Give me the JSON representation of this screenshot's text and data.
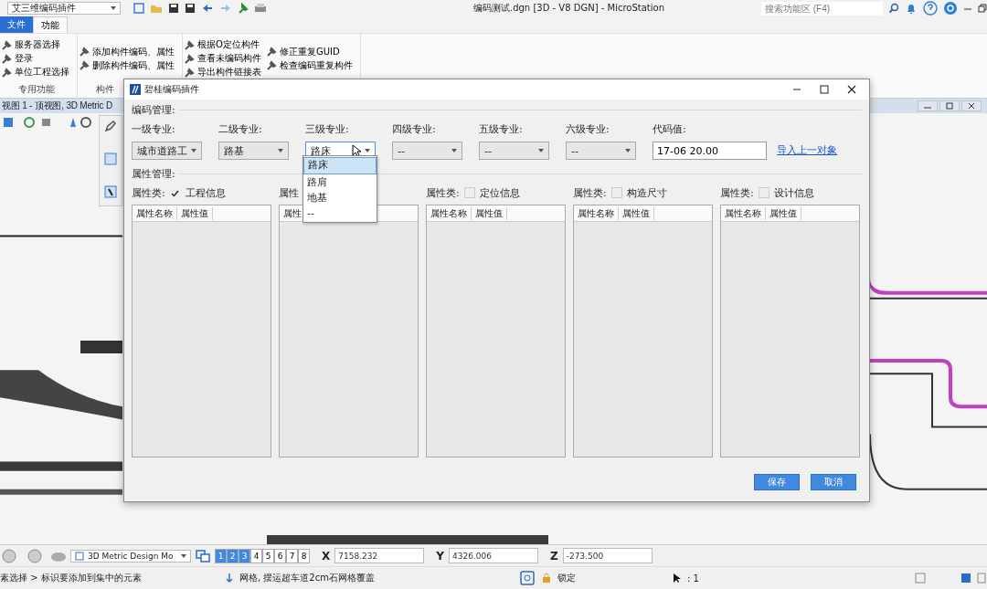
{
  "app_bar": {
    "workflow": "艾三维编码插件",
    "title": "编码测试.dgn [3D - V8 DGN] - MicroStation",
    "search": {
      "placeholder": "搜索功能区 (F4)"
    }
  },
  "ribbon": {
    "tabs": [
      {
        "label": "文件",
        "kind": "file",
        "selected": false
      },
      {
        "label": "功能",
        "kind": "tab",
        "selected": true
      }
    ],
    "groups": [
      {
        "label": "专用功能",
        "columns": [
          [
            "服务器选择",
            "登录",
            "单位工程选择"
          ]
        ]
      },
      {
        "label": "构件",
        "columns": [
          [
            "添加构件编码、属性",
            "删除构件编码、属性"
          ]
        ]
      },
      {
        "columns": [
          [
            "根据O定位构件",
            "查看未编码构件",
            "导出构件链接表"
          ],
          [
            "修正重复GUID",
            "检查编码重复构件"
          ]
        ]
      }
    ]
  },
  "view": {
    "title": "视图 1 - 顶视图, 3D Metric D"
  },
  "dialog": {
    "title": "碧桂编码插件",
    "code_section": "编码管理:",
    "levels": [
      {
        "label": "一级专业:",
        "value": "城市道路工",
        "expanded": false
      },
      {
        "label": "二级专业:",
        "value": "路基",
        "expanded": false
      },
      {
        "label": "三级专业:",
        "value": "路床",
        "expanded": true,
        "options": [
          {
            "label": "路床",
            "selected": true
          },
          {
            "label": "路肩",
            "selected": false
          },
          {
            "label": "地基",
            "selected": false
          },
          {
            "label": "--",
            "selected": false
          }
        ]
      },
      {
        "label": "四级专业:",
        "value": "--",
        "expanded": false
      },
      {
        "label": "五级专业:",
        "value": "--",
        "expanded": false
      },
      {
        "label": "六级专业:",
        "value": "--",
        "expanded": false
      }
    ],
    "code": {
      "label": "代码值:",
      "value": "17-06 20.00"
    },
    "import_link": "导入上一对象",
    "attr_section": "属性管理:",
    "panels": [
      {
        "label": "属性类:",
        "checked": true,
        "name": "工程信息",
        "columns": [
          "属性名称",
          "属性值"
        ]
      },
      {
        "label": "属性",
        "columns": [
          "属性"
        ]
      },
      {
        "label": "属性类:",
        "checked": false,
        "name": "定位信息",
        "columns": [
          "属性名称",
          "属性值"
        ]
      },
      {
        "label": "属性类:",
        "checked": false,
        "name": "构造尺寸",
        "columns": [
          "属性名称",
          "属性值"
        ]
      },
      {
        "label": "属性类:",
        "checked": false,
        "name": "设计信息",
        "columns": [
          "属性名称",
          "属性值"
        ]
      }
    ],
    "buttons": [
      "保存",
      "取消"
    ]
  },
  "status_bar": {
    "model": "3D Metric Design Mo",
    "views": [
      {
        "label": "1",
        "selected": true
      },
      {
        "label": "2",
        "selected": true
      },
      {
        "label": "3",
        "selected": true
      },
      {
        "label": "4",
        "selected": false
      },
      {
        "label": "5",
        "selected": false
      },
      {
        "label": "6",
        "selected": false
      },
      {
        "label": "7",
        "selected": false
      },
      {
        "label": "8",
        "selected": false
      }
    ],
    "coords": [
      {
        "axis": "X",
        "value": "7158.232"
      },
      {
        "axis": "Y",
        "value": "4326.006"
      },
      {
        "axis": "Z",
        "value": "-273.500"
      }
    ],
    "prompt": "素选择 > 标识要添加到集中的元素",
    "message": "网格, 摆运超车道2cm石网格覆盖",
    "lock": "锁定",
    "selection": ": 1"
  }
}
